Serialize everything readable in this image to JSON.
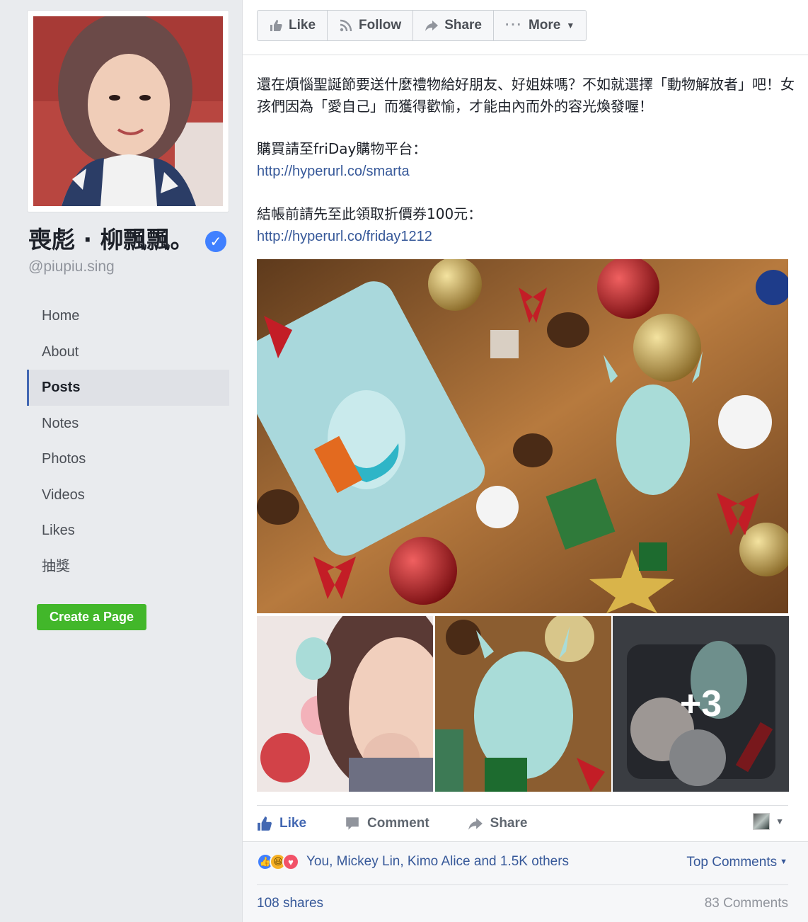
{
  "sidebar": {
    "page_name": "喪彪 · 柳飄飄。",
    "handle": "@piupiu.sing",
    "nav": [
      {
        "label": "Home"
      },
      {
        "label": "About"
      },
      {
        "label": "Posts",
        "active": true
      },
      {
        "label": "Notes"
      },
      {
        "label": "Photos"
      },
      {
        "label": "Videos"
      },
      {
        "label": "Likes"
      },
      {
        "label": "抽獎"
      }
    ],
    "create_page_label": "Create a Page"
  },
  "topbar": {
    "like_label": "Like",
    "follow_label": "Follow",
    "share_label": "Share",
    "more_label": "More"
  },
  "post": {
    "paragraph1": "還在煩惱聖誕節要送什麼禮物給好朋友、好姐妹嗎？不如就選擇「動物解放者」吧！女孩們因為「愛自己」而獲得歡愉，才能由內而外的容光煥發喔！",
    "buy_text": "購買請至friDay購物平台：",
    "buy_link": "http://hyperurl.co/smarta",
    "coupon_text": "結帳前請先至此領取折價券100元：",
    "coupon_link": "http://hyperurl.co/friday1212",
    "more_photos_label": "+3"
  },
  "post_actions": {
    "like_label": "Like",
    "comment_label": "Comment",
    "share_label": "Share"
  },
  "footer": {
    "reactions_text": "You, Mickey Lin, Kimo Alice and 1.5K others",
    "top_comments_label": "Top Comments",
    "shares_text": "108 shares",
    "comments_text": "83 Comments"
  },
  "colors": {
    "link": "#365899",
    "green_button": "#42b72a",
    "accent": "#4267b2"
  }
}
